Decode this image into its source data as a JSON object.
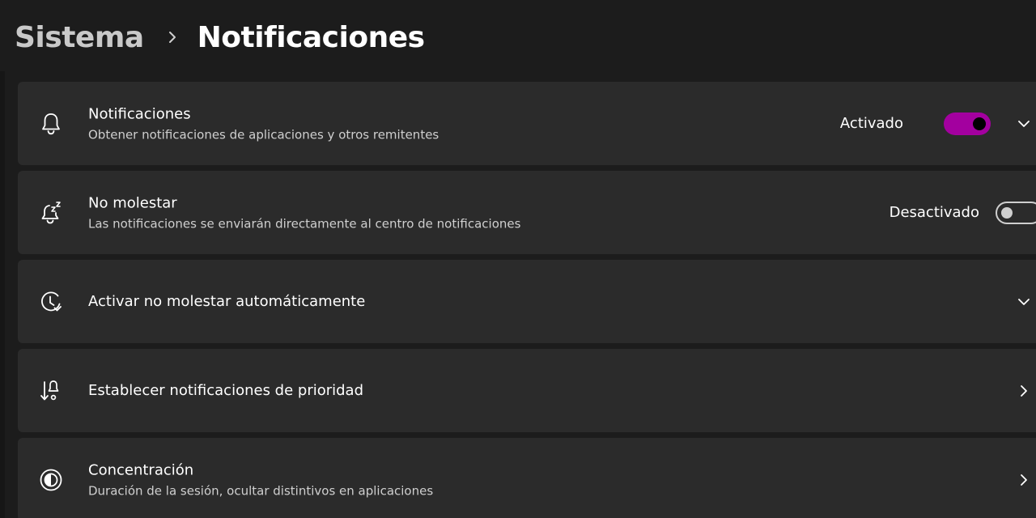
{
  "breadcrumb": {
    "parent": "Sistema",
    "current": "Notificaciones"
  },
  "colors": {
    "accent": "#a3009f",
    "card_bg": "#2b2b2b",
    "window_bg": "#1c1c1c"
  },
  "settings": [
    {
      "icon": "bell-icon",
      "title": "Notificaciones",
      "subtitle": "Obtener notificaciones de aplicaciones y otros remitentes",
      "state_label": "Activado",
      "toggle": "on",
      "trailing": "chevron-down-icon"
    },
    {
      "icon": "bell-snooze-icon",
      "title": "No molestar",
      "subtitle": "Las notificaciones se enviarán directamente al centro de notificaciones",
      "state_label": "Desactivado",
      "toggle": "off"
    },
    {
      "icon": "clock-icon",
      "title": "Activar no molestar automáticamente",
      "trailing": "chevron-down-icon"
    },
    {
      "icon": "priority-icon",
      "title": "Establecer notificaciones de prioridad",
      "trailing": "chevron-right-icon"
    },
    {
      "icon": "focus-icon",
      "title": "Concentración",
      "subtitle": "Duración de la sesión, ocultar distintivos en aplicaciones",
      "trailing": "chevron-right-icon"
    }
  ]
}
